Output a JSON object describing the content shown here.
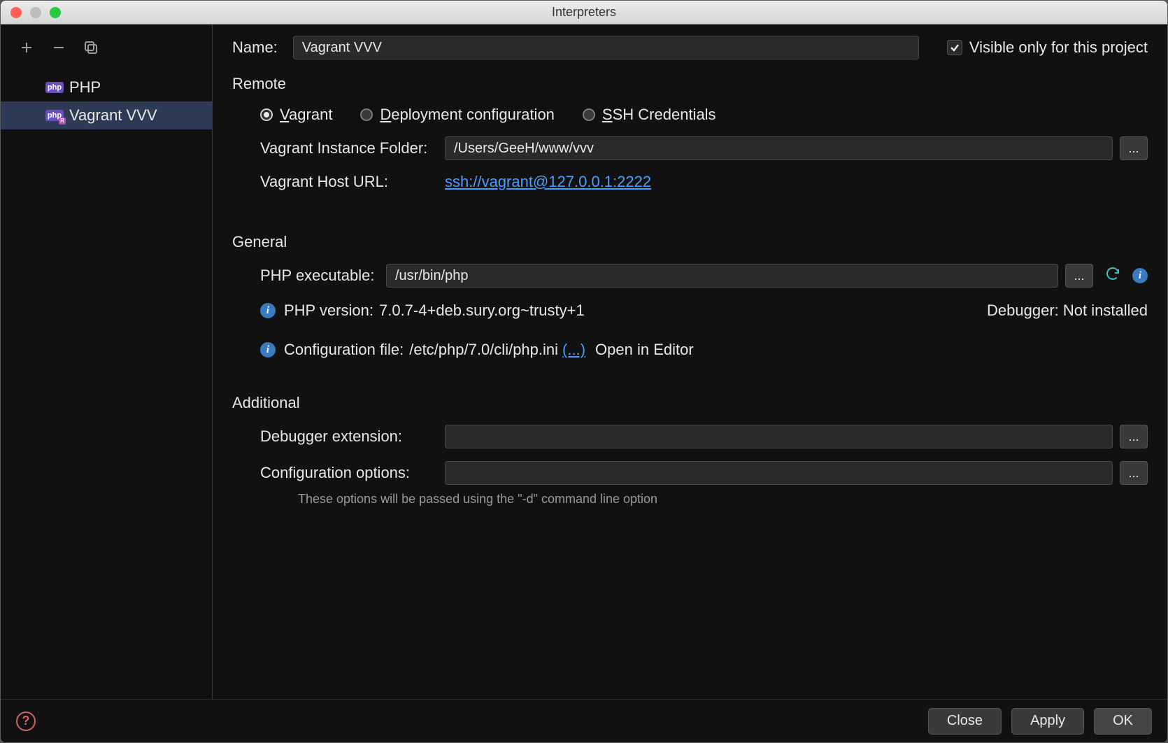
{
  "window": {
    "title": "Interpreters"
  },
  "sidebar": {
    "toolbar": {
      "add": "+",
      "remove": "−",
      "copy": "⧉"
    },
    "items": [
      {
        "icon": "php",
        "remote": false,
        "label": "PHP"
      },
      {
        "icon": "php",
        "remote": true,
        "label": "Vagrant VVV"
      }
    ],
    "selected_index": 1
  },
  "name": {
    "label": "Name:",
    "value": "Vagrant VVV"
  },
  "visible_project": {
    "label": "Visible only for this project",
    "checked": true
  },
  "remote": {
    "section": "Remote",
    "options": {
      "vagrant": "Vagrant",
      "deployment": "Deployment configuration",
      "ssh": "SSH Credentials"
    },
    "selected": "vagrant",
    "instance_folder": {
      "label": "Vagrant Instance Folder:",
      "value": "/Users/GeeH/www/vvv"
    },
    "host_url": {
      "label": "Vagrant Host URL:",
      "value": "ssh://vagrant@127.0.0.1:2222"
    }
  },
  "general": {
    "section": "General",
    "executable": {
      "label": "PHP executable:",
      "value": "/usr/bin/php"
    },
    "php_version": {
      "label": "PHP version:",
      "value": "7.0.7-4+deb.sury.org~trusty+1"
    },
    "debugger": {
      "label": "Debugger:",
      "value": "Not installed"
    },
    "config_file": {
      "label": "Configuration file:",
      "value": "/etc/php/7.0/cli/php.ini",
      "more": "(...)",
      "open": "Open in Editor"
    }
  },
  "additional": {
    "section": "Additional",
    "debugger_ext": {
      "label": "Debugger extension:",
      "value": ""
    },
    "config_opts": {
      "label": "Configuration options:",
      "value": ""
    },
    "hint": "These options will be passed using the \"-d\" command line option"
  },
  "buttons": {
    "close": "Close",
    "apply": "Apply",
    "ok": "OK"
  }
}
